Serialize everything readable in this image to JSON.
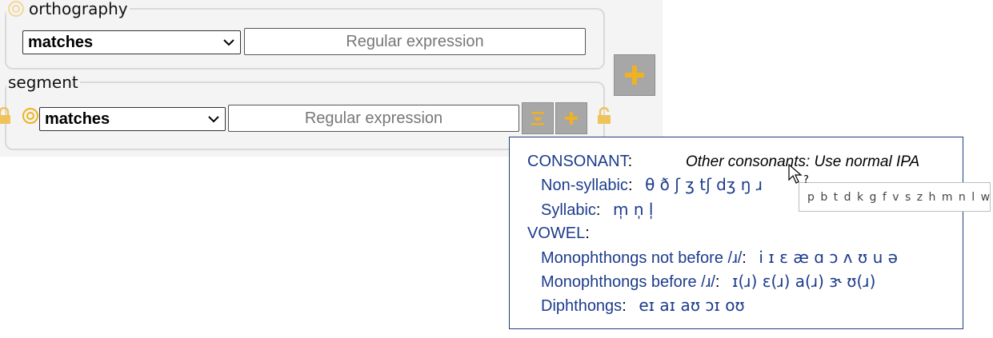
{
  "orthography": {
    "legend": "orthography",
    "operator": "matches",
    "regex_placeholder": "Regular expression"
  },
  "segment": {
    "legend": "segment",
    "operator": "matches",
    "regex_placeholder": "Regular expression"
  },
  "add_layer_button": "+",
  "segment_buttons": {
    "remove": "−",
    "add": "+"
  },
  "popup": {
    "consonant_heading": "CONSONANT",
    "note": "Other consonants: Use normal IPA",
    "non_syllabic_label": "Non-syllabic",
    "non_syllabic_symbols": "θ ð ʃ ʒ tʃ dʒ ŋ ɹ",
    "syllabic_label": "Syllabic",
    "syllabic_symbols": "m̩ n̩ l̩",
    "vowel_heading": "VOWEL",
    "mono_not_before_label": "Monophthongs not before /ɹ/",
    "mono_not_before_symbols": "i ɪ ɛ æ ɑ ɔ ʌ ʊ u ə",
    "mono_before_label": "Monophthongs before /ɹ/",
    "mono_before_symbols": "ɪ(ɹ) ɛ(ɹ) a(ɹ) ɝ ʊ(ɹ)",
    "diphthongs_label": "Diphthongs",
    "diphthongs_symbols": "eɪ aɪ aʊ ɔɪ oʊ"
  },
  "tooltip": "p b t d k g f v s z h m n l w j",
  "colors": {
    "accent": "#f0b21f",
    "popup_text": "#1c3c8c",
    "panel_bg": "#f4f4f4",
    "button_bg": "#a7a7a7"
  },
  "icons": {
    "target": "target-icon",
    "lock": "lock-icon",
    "chevron": "chevron-down-icon",
    "plus": "plus-icon",
    "minus": "minus-icon",
    "cursor": "cursor-help-icon"
  }
}
